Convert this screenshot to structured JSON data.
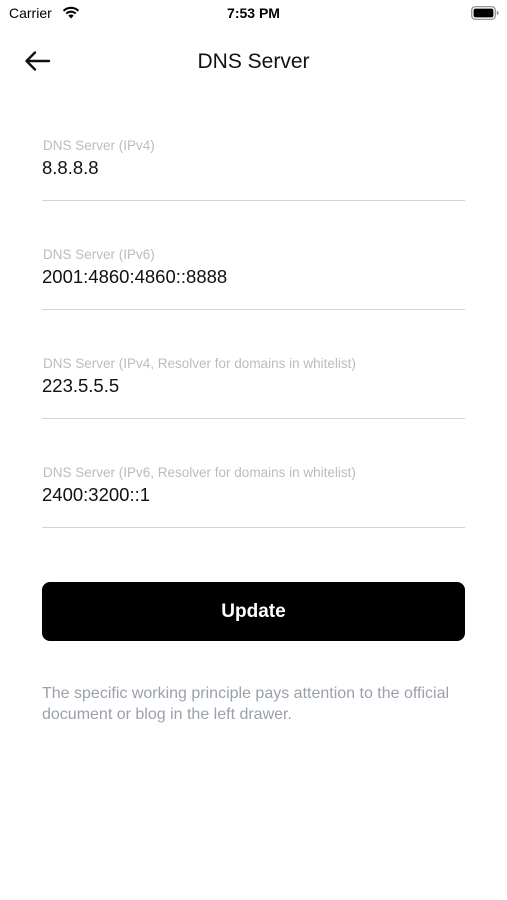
{
  "status_bar": {
    "carrier": "Carrier",
    "time": "7:53 PM"
  },
  "header": {
    "back_icon": "arrow-left-icon",
    "title": "DNS Server"
  },
  "fields": [
    {
      "label": "DNS Server (IPv4)",
      "value": "8.8.8.8"
    },
    {
      "label": "DNS Server (IPv6)",
      "value": "2001:4860:4860::8888"
    },
    {
      "label": "DNS Server (IPv4, Resolver for domains in whitelist)",
      "value": "223.5.5.5"
    },
    {
      "label": "DNS Server (IPv6, Resolver for domains in whitelist)",
      "value": "2400:3200::1"
    }
  ],
  "update_button": {
    "label": "Update"
  },
  "hint": "The specific working principle pays attention to the official document or blog in the left drawer.",
  "colors": {
    "button_bg": "#000000",
    "button_text": "#ffffff",
    "label": "#b8bcc3",
    "hint": "#9aa1ab",
    "divider": "#d4d4d4"
  }
}
